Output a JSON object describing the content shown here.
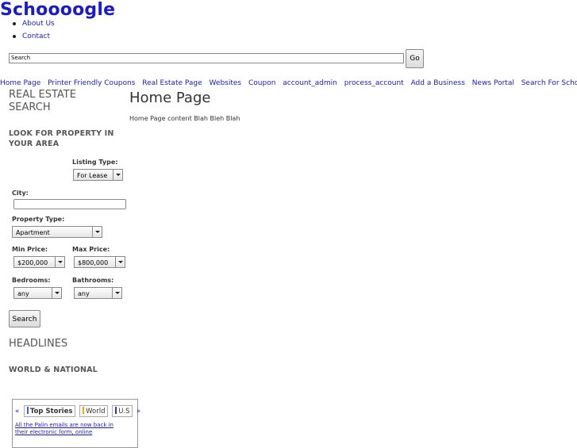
{
  "logo": "Schoooogle",
  "top_links": [
    "About Us",
    "Contact"
  ],
  "search": {
    "value": "Search",
    "button": "Go"
  },
  "nav": [
    "Home Page",
    "Printer Friendly Coupons",
    "Real Estate Page",
    "Websites",
    "Coupon",
    "account_admin",
    "process_account",
    "Add a Business",
    "News Portal",
    "Search For School"
  ],
  "sidebar": {
    "title_line1": "REAL ESTATE",
    "title_line2": "SEARCH",
    "subtitle_line1": "LOOK FOR PROPERTY IN",
    "subtitle_line2": "YOUR AREA",
    "listing_type_label": "Listing Type:",
    "listing_type_value": "For Lease",
    "city_label": "City:",
    "property_type_label": "Property Type:",
    "property_type_value": "Apartment",
    "min_price_label": "Min Price:",
    "min_price_value": "$200,000",
    "max_price_label": "Max Price:",
    "max_price_value": "$800,000",
    "bedrooms_label": "Bedrooms:",
    "bedrooms_value": "any",
    "bathrooms_label": "Bathrooms:",
    "bathrooms_value": "any",
    "search_button": "Search",
    "headlines": "HEADLINES",
    "world_national": "WORLD & NATIONAL"
  },
  "main": {
    "title": "Home Page",
    "body": "Home Page content Blah Bleh Blah"
  },
  "news_widget": {
    "prev": "«",
    "next": "»",
    "tabs": [
      "Top Stories",
      "World",
      "U.S"
    ],
    "tab_colors": [
      "#3366cc",
      "#e8a800",
      "#3333aa"
    ],
    "headline": "All the Palin emails are now back in their electronic form, online"
  }
}
